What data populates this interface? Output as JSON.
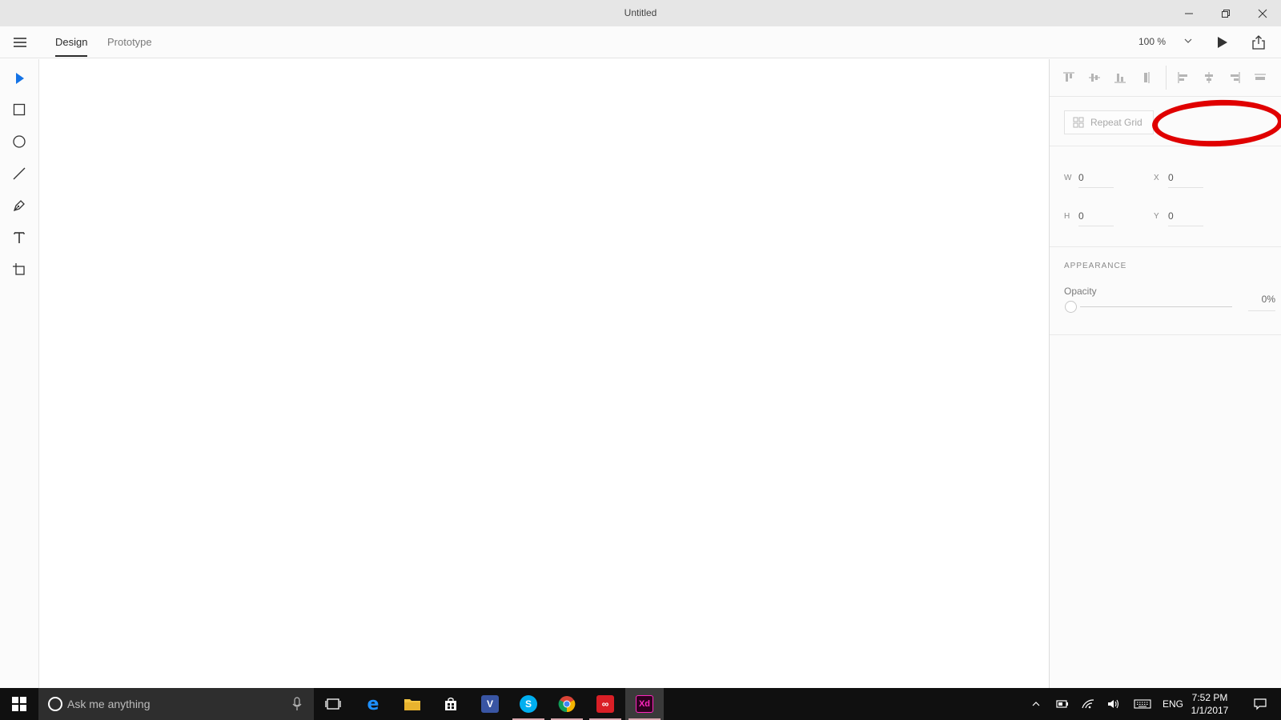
{
  "window": {
    "title": "Untitled",
    "controls": [
      "minimize-icon",
      "restore-icon",
      "close-icon"
    ]
  },
  "header": {
    "menu_icon": "hamburger-icon",
    "tabs": [
      {
        "label": "Design",
        "active": true
      },
      {
        "label": "Prototype",
        "active": false
      }
    ],
    "zoom": "100 %",
    "play_icon": "play-icon",
    "share_icon": "share-icon"
  },
  "tools": [
    {
      "name": "select-tool",
      "icon": "arrow-icon",
      "active": true
    },
    {
      "name": "rectangle-tool",
      "icon": "rectangle-icon"
    },
    {
      "name": "ellipse-tool",
      "icon": "ellipse-icon"
    },
    {
      "name": "line-tool",
      "icon": "line-icon"
    },
    {
      "name": "pen-tool",
      "icon": "pen-icon"
    },
    {
      "name": "text-tool",
      "icon": "text-icon"
    },
    {
      "name": "artboard-tool",
      "icon": "artboard-icon"
    }
  ],
  "panel": {
    "repeat_grid": "Repeat Grid",
    "w_label": "W",
    "w_value": "0",
    "x_label": "X",
    "x_value": "0",
    "h_label": "H",
    "h_value": "0",
    "y_label": "Y",
    "y_value": "0",
    "appearance_title": "APPEARANCE",
    "opacity_label": "Opacity",
    "opacity_value": "0%"
  },
  "taskbar": {
    "search_placeholder": "Ask me anything",
    "apps": [
      "task-view",
      "edge",
      "file-explorer",
      "store",
      "visio",
      "skype",
      "chrome",
      "creative-cloud",
      "adobe-xd"
    ],
    "language": "ENG",
    "time": "7:52 PM",
    "date": "1/1/2017"
  },
  "colors": {
    "accent": "#1473e6",
    "annotation": "#e00000",
    "xd_brand": "#ff26be",
    "xd_bg": "#2e001f"
  }
}
